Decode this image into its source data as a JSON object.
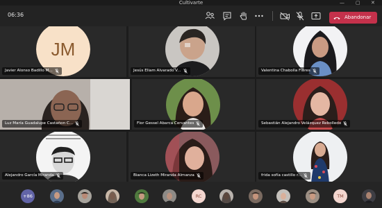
{
  "window": {
    "title": "Cultivarte",
    "controls": [
      "—",
      "▢",
      "✕"
    ]
  },
  "toolbar": {
    "timer": "06:36",
    "icons": [
      "people-icon",
      "chat-icon",
      "raise-hand-icon",
      "more-icon",
      "camera-off-icon",
      "mic-off-icon",
      "share-icon"
    ],
    "leave_label": "Abandonar"
  },
  "participants": [
    {
      "name": "Javier Alonso Badillo M...",
      "initials": "JM",
      "avatar_color": "#f8e1c8",
      "initials_color": "#8a5a2e"
    },
    {
      "name": "Jesús Eliam Alvarado V..."
    },
    {
      "name": "Valentina Chabolla Flores"
    },
    {
      "name": "Luz María Guadalupe Castañon C..."
    },
    {
      "name": "Flor Gessel Abarca Cervantes"
    },
    {
      "name": "Sebastián Alejandro Velázquez Rebolledo"
    },
    {
      "name": "Alejandro García Miranda"
    },
    {
      "name": "Bianca Lizeth Miranda Almanza"
    },
    {
      "name": "frida sofía castillo r..."
    }
  ],
  "bottom_bar": {
    "overflow_count": "+86",
    "overflow_color": "#6264a7",
    "initial_badges": [
      "RC",
      "TM"
    ]
  }
}
